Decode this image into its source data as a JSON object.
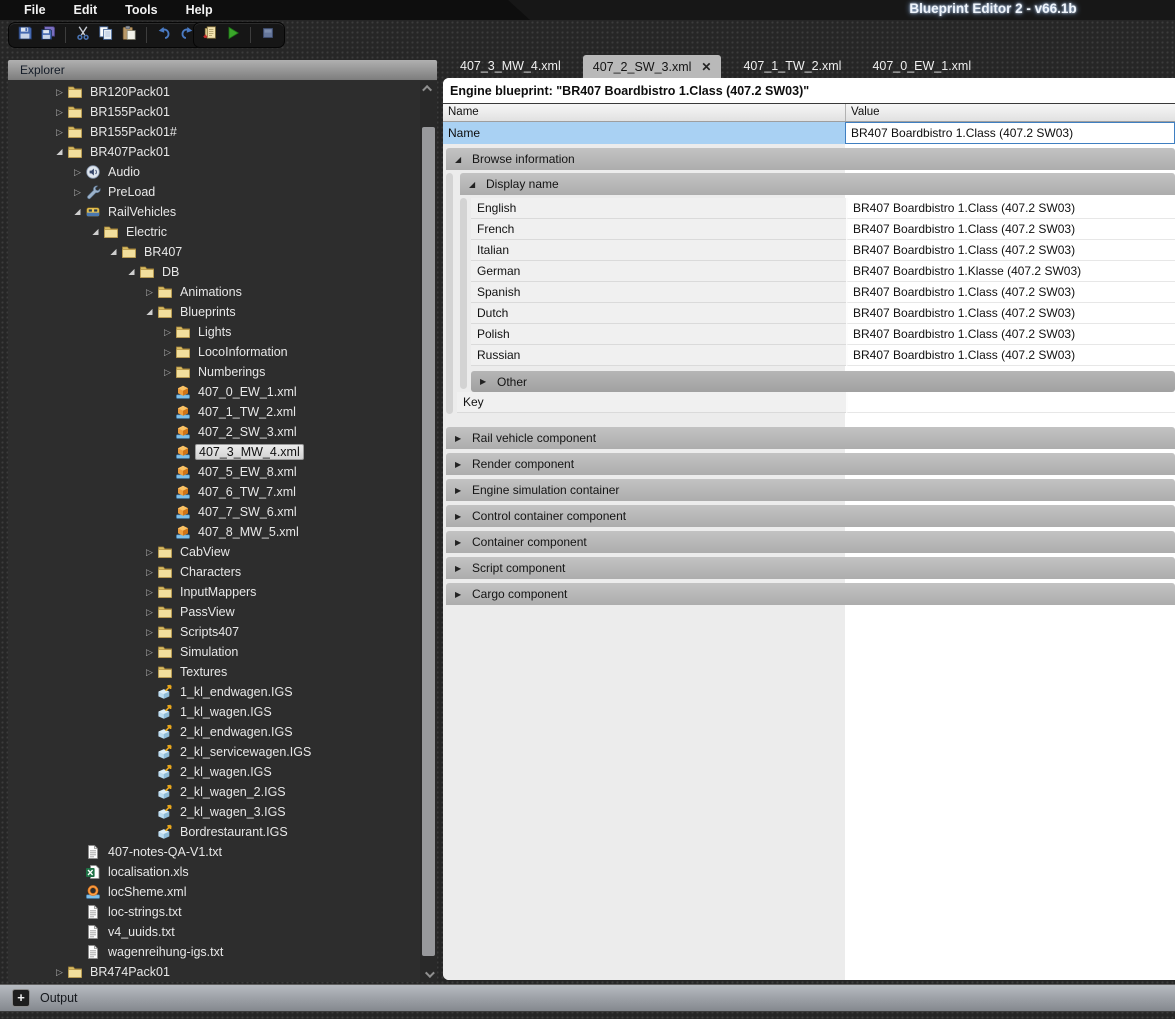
{
  "window": {
    "title": "Blueprint Editor 2 - v66.1b"
  },
  "menu_items": [
    "File",
    "Edit",
    "Tools",
    "Help"
  ],
  "toolbar_groups": [
    [
      "save",
      "save-all",
      "|",
      "cut",
      "copy",
      "paste",
      "|",
      "undo",
      "redo"
    ],
    [
      "export",
      "run",
      "|",
      "stop"
    ]
  ],
  "explorer": {
    "header": "Explorer",
    "tree": [
      {
        "label": "BR120Pack01",
        "level": 1,
        "icon": "folder",
        "state": "c"
      },
      {
        "label": "BR155Pack01",
        "level": 1,
        "icon": "folder",
        "state": "c"
      },
      {
        "label": "BR155Pack01#",
        "level": 1,
        "icon": "folder",
        "state": "c"
      },
      {
        "label": "BR407Pack01",
        "level": 1,
        "icon": "folder",
        "state": "e"
      },
      {
        "label": "Audio",
        "level": 2,
        "icon": "audio",
        "state": "c"
      },
      {
        "label": "PreLoad",
        "level": 2,
        "icon": "preload",
        "state": "c"
      },
      {
        "label": "RailVehicles",
        "level": 2,
        "icon": "railvehicles",
        "state": "e"
      },
      {
        "label": "Electric",
        "level": 3,
        "icon": "folder",
        "state": "e"
      },
      {
        "label": "BR407",
        "level": 4,
        "icon": "folder",
        "state": "e"
      },
      {
        "label": "DB",
        "level": 5,
        "icon": "folder",
        "state": "e"
      },
      {
        "label": "Animations",
        "level": 6,
        "icon": "folder",
        "state": "c"
      },
      {
        "label": "Blueprints",
        "level": 6,
        "icon": "folder",
        "state": "e"
      },
      {
        "label": "Lights",
        "level": 7,
        "icon": "folder",
        "state": "c"
      },
      {
        "label": "LocoInformation",
        "level": 7,
        "icon": "folder",
        "state": "c"
      },
      {
        "label": "Numberings",
        "level": 7,
        "icon": "folder",
        "state": "c"
      },
      {
        "label": "407_0_EW_1.xml",
        "level": 7,
        "icon": "blueprint",
        "state": ""
      },
      {
        "label": "407_1_TW_2.xml",
        "level": 7,
        "icon": "blueprint",
        "state": ""
      },
      {
        "label": "407_2_SW_3.xml",
        "level": 7,
        "icon": "blueprint",
        "state": ""
      },
      {
        "label": "407_3_MW_4.xml",
        "level": 7,
        "icon": "blueprint",
        "state": "",
        "selected": true
      },
      {
        "label": "407_5_EW_8.xml",
        "level": 7,
        "icon": "blueprint",
        "state": ""
      },
      {
        "label": "407_6_TW_7.xml",
        "level": 7,
        "icon": "blueprint",
        "state": ""
      },
      {
        "label": "407_7_SW_6.xml",
        "level": 7,
        "icon": "blueprint",
        "state": ""
      },
      {
        "label": "407_8_MW_5.xml",
        "level": 7,
        "icon": "blueprint",
        "state": ""
      },
      {
        "label": "CabView",
        "level": 6,
        "icon": "folder",
        "state": "c"
      },
      {
        "label": "Characters",
        "level": 6,
        "icon": "folder",
        "state": "c"
      },
      {
        "label": "InputMappers",
        "level": 6,
        "icon": "folder",
        "state": "c"
      },
      {
        "label": "PassView",
        "level": 6,
        "icon": "folder",
        "state": "c"
      },
      {
        "label": "Scripts407",
        "level": 6,
        "icon": "folder",
        "state": "c"
      },
      {
        "label": "Simulation",
        "level": 6,
        "icon": "folder",
        "state": "c"
      },
      {
        "label": "Textures",
        "level": 6,
        "icon": "folder",
        "state": "c"
      },
      {
        "label": "1_kl_endwagen.IGS",
        "level": 6,
        "icon": "igs",
        "state": ""
      },
      {
        "label": "1_kl_wagen.IGS",
        "level": 6,
        "icon": "igs",
        "state": ""
      },
      {
        "label": "2_kl_endwagen.IGS",
        "level": 6,
        "icon": "igs",
        "state": ""
      },
      {
        "label": "2_kl_servicewagen.IGS",
        "level": 6,
        "icon": "igs",
        "state": ""
      },
      {
        "label": "2_kl_wagen.IGS",
        "level": 6,
        "icon": "igs",
        "state": ""
      },
      {
        "label": "2_kl_wagen_2.IGS",
        "level": 6,
        "icon": "igs",
        "state": ""
      },
      {
        "label": "2_kl_wagen_3.IGS",
        "level": 6,
        "icon": "igs",
        "state": ""
      },
      {
        "label": "Bordrestaurant.IGS",
        "level": 6,
        "icon": "igs",
        "state": ""
      },
      {
        "label": "407-notes-QA-V1.txt",
        "level": 2,
        "icon": "txt",
        "state": ""
      },
      {
        "label": "localisation.xls",
        "level": 2,
        "icon": "xls",
        "state": ""
      },
      {
        "label": "locSheme.xml",
        "level": 2,
        "icon": "locscheme",
        "state": ""
      },
      {
        "label": "loc-strings.txt",
        "level": 2,
        "icon": "txt",
        "state": ""
      },
      {
        "label": "v4_uuids.txt",
        "level": 2,
        "icon": "txt",
        "state": ""
      },
      {
        "label": "wagenreihung-igs.txt",
        "level": 2,
        "icon": "txt",
        "state": ""
      },
      {
        "label": "BR474Pack01",
        "level": 1,
        "icon": "folder",
        "state": "c"
      }
    ]
  },
  "tabs": [
    {
      "label": "407_3_MW_4.xml",
      "active": false
    },
    {
      "label": "407_2_SW_3.xml",
      "active": true,
      "close": "✕"
    },
    {
      "label": "407_1_TW_2.xml",
      "active": false
    },
    {
      "label": "407_0_EW_1.xml",
      "active": false
    }
  ],
  "editor": {
    "title": "Engine blueprint: \"BR407 Boardbistro 1.Class (407.2 SW03)\"",
    "columns": {
      "name": "Name",
      "value": "Value"
    },
    "selected_row": {
      "name": "Name",
      "value": "BR407 Boardbistro 1.Class (407.2 SW03)"
    },
    "browse_section": {
      "label": "Browse information",
      "display_name": {
        "label": "Display name",
        "rows": [
          {
            "name": "English",
            "value": "BR407 Boardbistro 1.Class (407.2 SW03)"
          },
          {
            "name": "French",
            "value": "BR407 Boardbistro 1.Class (407.2 SW03)"
          },
          {
            "name": "Italian",
            "value": "BR407 Boardbistro 1.Class (407.2 SW03)"
          },
          {
            "name": "German",
            "value": "BR407 Boardbistro 1.Klasse (407.2 SW03)"
          },
          {
            "name": "Spanish",
            "value": "BR407 Boardbistro 1.Class (407.2 SW03)"
          },
          {
            "name": "Dutch",
            "value": "BR407 Boardbistro 1.Class (407.2 SW03)"
          },
          {
            "name": "Polish",
            "value": "BR407 Boardbistro 1.Class (407.2 SW03)"
          },
          {
            "name": "Russian",
            "value": "BR407 Boardbistro 1.Class (407.2 SW03)"
          }
        ],
        "other": {
          "label": "Other"
        }
      },
      "key_row": {
        "name": "Key",
        "value": ""
      }
    },
    "component_sections": [
      "Rail vehicle component",
      "Render component",
      "Engine simulation container",
      "Control container component",
      "Container component",
      "Script component",
      "Cargo component"
    ]
  },
  "output_bar": {
    "label": "Output",
    "expand_button": "+"
  },
  "colors": {
    "selection_blue": "#a9d1f3",
    "focus_border": "#3f7fc1",
    "category_gray": "#b3b3b3",
    "panel_gray": "#ececec",
    "chrome_dark": "#262626",
    "folder_yellow": "#f0dc9a"
  }
}
